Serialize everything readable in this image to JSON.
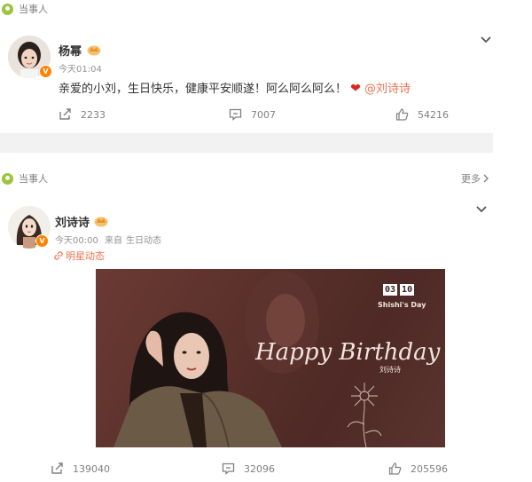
{
  "post1": {
    "tag": "当事人",
    "author": "杨幂",
    "time": "今天01:04",
    "text": "亲爱的小刘，生日快乐，健康平安顺遂！阿么阿么阿么！",
    "mention": "@刘诗诗",
    "repost_count": "2233",
    "comment_count": "7007",
    "like_count": "54216"
  },
  "post2": {
    "tag": "当事人",
    "more_label": "更多",
    "author": "刘诗诗",
    "time": "今天00:00",
    "source_prefix": "来自",
    "source": "生日动态",
    "topic": "明星动态",
    "card": {
      "date_month": "03",
      "date_day": "10",
      "subtitle": "Shishi's Day",
      "script_text": "Happy Birthday",
      "name": "刘诗诗"
    },
    "repost_count": "139040",
    "comment_count": "32096",
    "like_count": "205596"
  },
  "colors": {
    "accent": "#eb7350",
    "tag_green": "#9bc53d",
    "verified": "#ff8200"
  }
}
